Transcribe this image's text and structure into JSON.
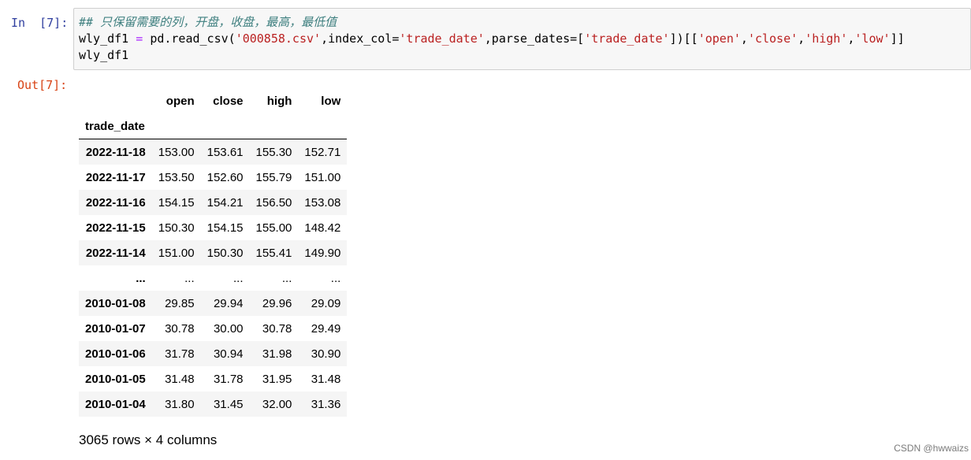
{
  "cell": {
    "in_prompt": "In  [7]:",
    "out_prompt": "Out[7]:",
    "code": {
      "comment": "## 只保留需要的列，开盘，收盘，最高，最低值",
      "line2_var": "wly_df1",
      "line2_eq": " = ",
      "line2_call": "pd.read_csv(",
      "line2_str1": "'000858.csv'",
      "line2_mid1": ",index_col=",
      "line2_str2": "'trade_date'",
      "line2_mid2": ",parse_dates=[",
      "line2_str3": "'trade_date'",
      "line2_mid3": "])[[",
      "line2_str4": "'open'",
      "line2_sep1": ",",
      "line2_str5": "'close'",
      "line2_sep2": ",",
      "line2_str6": "'high'",
      "line2_sep3": ",",
      "line2_str7": "'low'",
      "line2_end": "]]",
      "line3": "wly_df1"
    }
  },
  "dataframe": {
    "columns": [
      "open",
      "close",
      "high",
      "low"
    ],
    "index_name": "trade_date",
    "rows": [
      {
        "index": "2022-11-18",
        "values": [
          "153.00",
          "153.61",
          "155.30",
          "152.71"
        ]
      },
      {
        "index": "2022-11-17",
        "values": [
          "153.50",
          "152.60",
          "155.79",
          "151.00"
        ]
      },
      {
        "index": "2022-11-16",
        "values": [
          "154.15",
          "154.21",
          "156.50",
          "153.08"
        ]
      },
      {
        "index": "2022-11-15",
        "values": [
          "150.30",
          "154.15",
          "155.00",
          "148.42"
        ]
      },
      {
        "index": "2022-11-14",
        "values": [
          "151.00",
          "150.30",
          "155.41",
          "149.90"
        ]
      },
      {
        "index": "...",
        "values": [
          "...",
          "...",
          "...",
          "..."
        ]
      },
      {
        "index": "2010-01-08",
        "values": [
          "29.85",
          "29.94",
          "29.96",
          "29.09"
        ]
      },
      {
        "index": "2010-01-07",
        "values": [
          "30.78",
          "30.00",
          "30.78",
          "29.49"
        ]
      },
      {
        "index": "2010-01-06",
        "values": [
          "31.78",
          "30.94",
          "31.98",
          "30.90"
        ]
      },
      {
        "index": "2010-01-05",
        "values": [
          "31.48",
          "31.78",
          "31.95",
          "31.48"
        ]
      },
      {
        "index": "2010-01-04",
        "values": [
          "31.80",
          "31.45",
          "32.00",
          "31.36"
        ]
      }
    ],
    "shape_text": "3065 rows × 4 columns"
  },
  "watermark": "CSDN @hwwaizs"
}
